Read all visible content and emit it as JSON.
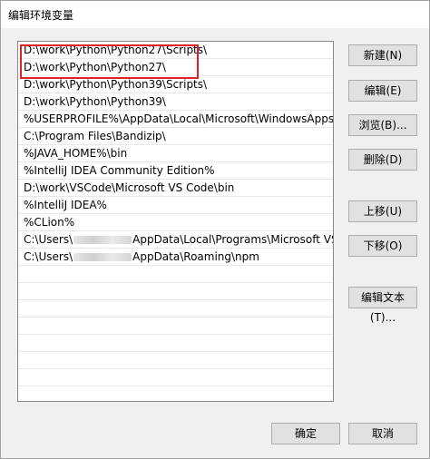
{
  "window": {
    "title": "编辑环境变量"
  },
  "list": {
    "items": [
      "D:\\work\\Python\\Python27\\Scripts\\",
      "D:\\work\\Python\\Python27\\",
      "D:\\work\\Python\\Python39\\Scripts\\",
      "D:\\work\\Python\\Python39\\",
      "%USERPROFILE%\\AppData\\Local\\Microsoft\\WindowsApps",
      "C:\\Program Files\\Bandizip\\",
      "%JAVA_HOME%\\bin",
      "%IntelliJ IDEA Community Edition%",
      "D:\\work\\VSCode\\Microsoft VS Code\\bin",
      "%IntelliJ IDEA%",
      "%CLion%"
    ],
    "redacted_items": [
      {
        "prefix": "C:\\Users\\",
        "suffix": "AppData\\Local\\Programs\\Microsoft VS "
      },
      {
        "prefix": "C:\\Users\\",
        "suffix": "AppData\\Roaming\\npm"
      }
    ]
  },
  "buttons": {
    "new": "新建(N)",
    "edit": "编辑(E)",
    "browse": "浏览(B)...",
    "delete": "删除(D)",
    "move_up": "上移(U)",
    "move_down": "下移(O)",
    "edit_text": "编辑文本(T)...",
    "ok": "确定",
    "cancel": "取消"
  },
  "colors": {
    "highlight": "#e0202a",
    "selection": "#cce8ff"
  }
}
